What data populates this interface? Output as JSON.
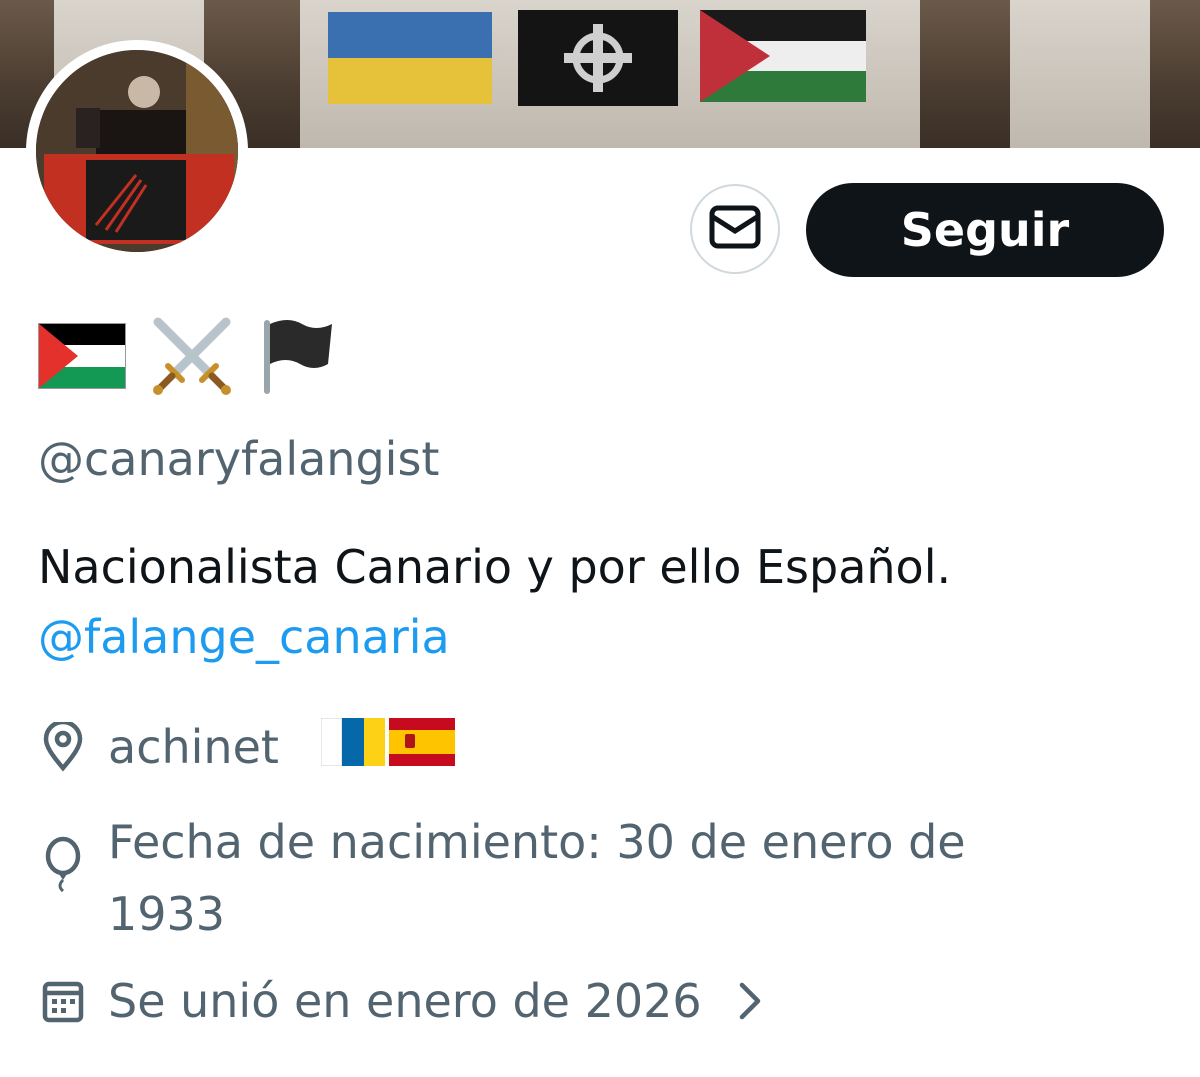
{
  "profile": {
    "handle": "@canaryfalangist",
    "bio_text": "Nacionalista Canario y por ello Español.",
    "bio_mention": "@falange_canaria",
    "location": "achinet",
    "birth": "Fecha de nacimiento: 30 de enero de 1933",
    "joined": "Se unió en enero de 2026",
    "name_emojis": [
      "palestine-flag",
      "crossed-swords",
      "black-flag"
    ],
    "location_flags": [
      "canary-islands-flag",
      "spain-flag"
    ]
  },
  "actions": {
    "follow_label": "Seguir",
    "message_icon": "envelope-icon"
  },
  "colors": {
    "text_primary": "#0f1419",
    "text_secondary": "#536471",
    "link": "#1d9bf0",
    "button_dark": "#0f1419"
  }
}
